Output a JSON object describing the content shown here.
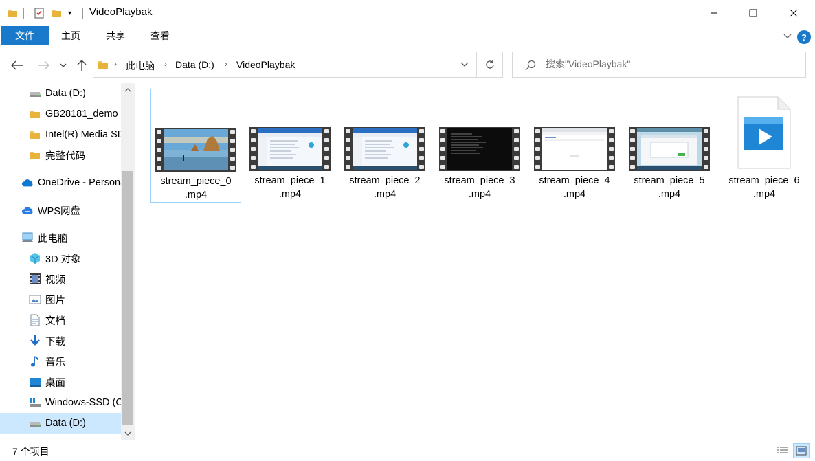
{
  "window": {
    "title": "VideoPlaybak",
    "controls": {
      "minimize": "minimize-icon",
      "maximize": "maximize-icon",
      "close": "close-icon"
    }
  },
  "ribbon": {
    "tabs": [
      {
        "label": "文件",
        "active": true
      },
      {
        "label": "主页"
      },
      {
        "label": "共享"
      },
      {
        "label": "查看"
      }
    ]
  },
  "address": {
    "segments": [
      "此电脑",
      "Data (D:)",
      "VideoPlaybak"
    ]
  },
  "search": {
    "placeholder": "搜索\"VideoPlaybak\""
  },
  "sidebar": {
    "items": [
      {
        "label": "Data (D:)",
        "icon": "drive-icon"
      },
      {
        "label": "GB28181_demo",
        "icon": "folder-icon"
      },
      {
        "label": "Intel(R) Media SDK",
        "icon": "folder-icon"
      },
      {
        "label": "完整代码",
        "icon": "folder-icon"
      },
      {
        "label": "OneDrive - Personal",
        "icon": "onedrive-icon"
      },
      {
        "label": "WPS网盘",
        "icon": "wps-cloud-icon"
      },
      {
        "label": "此电脑",
        "icon": "this-pc-icon"
      },
      {
        "label": "3D 对象",
        "icon": "3d-objects-icon"
      },
      {
        "label": "视频",
        "icon": "videos-icon"
      },
      {
        "label": "图片",
        "icon": "pictures-icon"
      },
      {
        "label": "文档",
        "icon": "documents-icon"
      },
      {
        "label": "下载",
        "icon": "downloads-icon"
      },
      {
        "label": "音乐",
        "icon": "music-icon"
      },
      {
        "label": "桌面",
        "icon": "desktop-icon"
      },
      {
        "label": "Windows-SSD (C:)",
        "icon": "windows-drive-icon"
      },
      {
        "label": "Data (D:)",
        "icon": "drive-icon",
        "selected": true
      }
    ]
  },
  "files": [
    {
      "name_line1": "stream_piece_0",
      "name_line2": ".mp4",
      "thumb": "landscape",
      "selected": true
    },
    {
      "name_line1": "stream_piece_1",
      "name_line2": ".mp4",
      "thumb": "explorer"
    },
    {
      "name_line1": "stream_piece_2",
      "name_line2": ".mp4",
      "thumb": "explorer"
    },
    {
      "name_line1": "stream_piece_3",
      "name_line2": ".mp4",
      "thumb": "console"
    },
    {
      "name_line1": "stream_piece_4",
      "name_line2": ".mp4",
      "thumb": "browser"
    },
    {
      "name_line1": "stream_piece_5",
      "name_line2": ".mp4",
      "thumb": "app"
    },
    {
      "name_line1": "stream_piece_6",
      "name_line2": ".mp4",
      "thumb": "video-file"
    }
  ],
  "status": {
    "item_count": "7 个项目"
  },
  "colors": {
    "accent": "#1979ca",
    "selection": "#cce8ff",
    "selection_border": "#99d1ff",
    "folder": "#f2c55c"
  }
}
